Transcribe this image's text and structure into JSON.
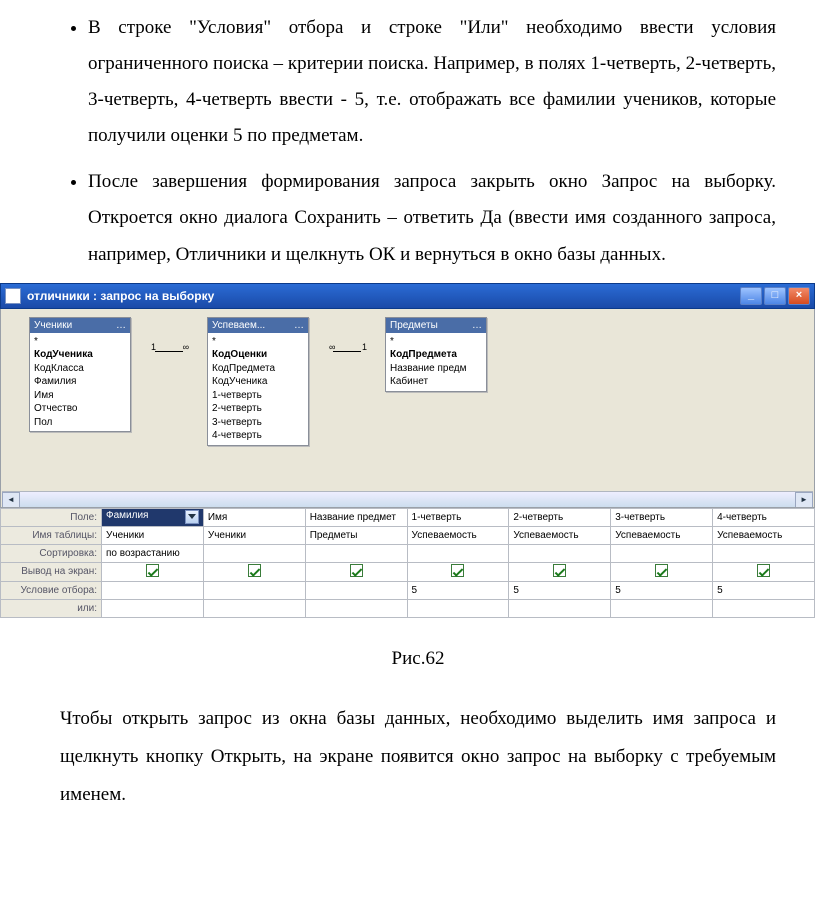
{
  "bullets": [
    "В строке \"Условия\" отбора и строке \"Или\" необходимо ввести условия ограниченного поиска – критерии поиска. Например, в полях 1-четверть, 2-четверть, 3-четверть, 4-четверть ввести - 5, т.е. отображать все фамилии учеников, которые получили оценки 5 по предметам.",
    "После завершения формирования запроса закрыть окно Запрос на выборку. Откроется окно диалога Сохранить – ответить Да (ввести имя созданного запроса, например, Отличники и щелкнуть ОК и вернуться в окно базы данных."
  ],
  "screenshot": {
    "title": "отличники : запрос на выборку",
    "win_btns": {
      "min": "_",
      "max": "□",
      "close": "×"
    },
    "tables": [
      {
        "title": "Ученики",
        "fields": [
          "*",
          "КодУченика",
          "КодКласса",
          "Фамилия",
          "Имя",
          "Отчество",
          "Пол"
        ],
        "bold": "КодУченика"
      },
      {
        "title": "Успеваем...",
        "fields": [
          "*",
          "КодОценки",
          "КодПредмета",
          "КодУченика",
          "1-четверть",
          "2-четверть",
          "3-четверть",
          "4-четверть"
        ],
        "bold": "КодОценки"
      },
      {
        "title": "Предметы",
        "fields": [
          "*",
          "КодПредмета",
          "Название предм",
          "Кабинет"
        ],
        "bold": "КодПредмета"
      }
    ]
  },
  "qbe": {
    "row_labels": [
      "Поле:",
      "Имя таблицы:",
      "Сортировка:",
      "Вывод на экран:",
      "Условие отбора:",
      "или:"
    ],
    "cols": [
      {
        "field": "Фамилия",
        "table": "Ученики",
        "sort": "по возрастанию",
        "show": true,
        "crit": "",
        "selected": true
      },
      {
        "field": "Имя",
        "table": "Ученики",
        "sort": "",
        "show": true,
        "crit": ""
      },
      {
        "field": "Название предмет",
        "table": "Предметы",
        "sort": "",
        "show": true,
        "crit": ""
      },
      {
        "field": "1-четверть",
        "table": "Успеваемость",
        "sort": "",
        "show": true,
        "crit": "5"
      },
      {
        "field": "2-четверть",
        "table": "Успеваемость",
        "sort": "",
        "show": true,
        "crit": "5"
      },
      {
        "field": "3-четверть",
        "table": "Успеваемость",
        "sort": "",
        "show": true,
        "crit": "5"
      },
      {
        "field": "4-четверть",
        "table": "Успеваемость",
        "sort": "",
        "show": true,
        "crit": "5"
      }
    ]
  },
  "caption": "Рис.62",
  "paragraph_after": "Чтобы открыть запрос из окна базы данных, необходимо выделить имя запроса и щелкнуть кнопку Открыть, на экране появится окно запрос на выборку с требуемым именем."
}
